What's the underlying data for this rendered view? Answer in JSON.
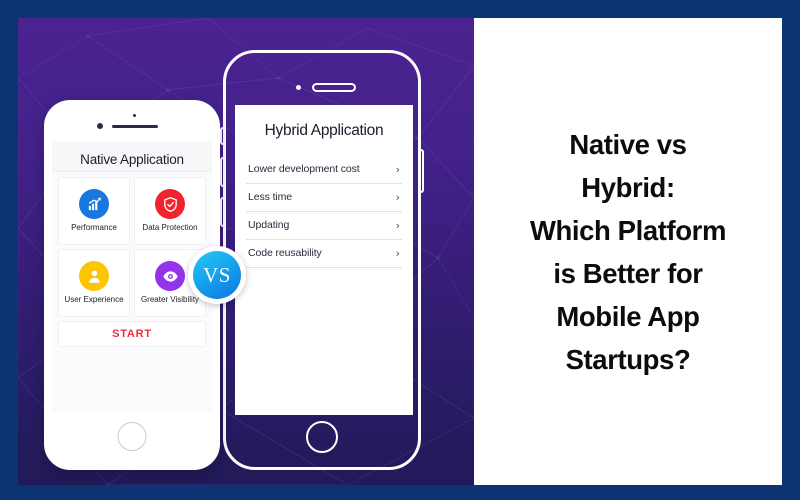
{
  "theme": {
    "border_color": "#0d3472",
    "panel_purple_top": "#4b2391",
    "panel_purple_bottom": "#211a58",
    "title_panel_bg": "#ffffff",
    "start_color": "#ef2b3c",
    "vs_gradient_from": "#28c8f5",
    "vs_gradient_to": "#0d74e0"
  },
  "native_phone": {
    "title": "Native Application",
    "features": [
      {
        "label": "Performance",
        "icon": "bar-chart-growth-icon",
        "color": "#1878e0"
      },
      {
        "label": "Data\nProtection",
        "icon": "shield-check-icon",
        "color": "#f0232e"
      },
      {
        "label": "User\nExperience",
        "icon": "user-person-icon",
        "color": "#fdc500"
      },
      {
        "label": "Greater\nVisibility",
        "icon": "eye-icon",
        "color": "#9333ea"
      }
    ],
    "start_button": "START"
  },
  "hybrid_phone": {
    "title": "Hybrid Application",
    "items": [
      {
        "label": "Lower development cost",
        "chevron": "›"
      },
      {
        "label": "Less time",
        "chevron": "›"
      },
      {
        "label": "Updating",
        "chevron": "›"
      },
      {
        "label": "Code reusability",
        "chevron": "›"
      }
    ]
  },
  "vs_badge": {
    "text": "VS"
  },
  "headline": {
    "lines": [
      "Native vs",
      "Hybrid:",
      "Which Platform",
      "is Better for",
      "Mobile App",
      "Startups?"
    ]
  }
}
